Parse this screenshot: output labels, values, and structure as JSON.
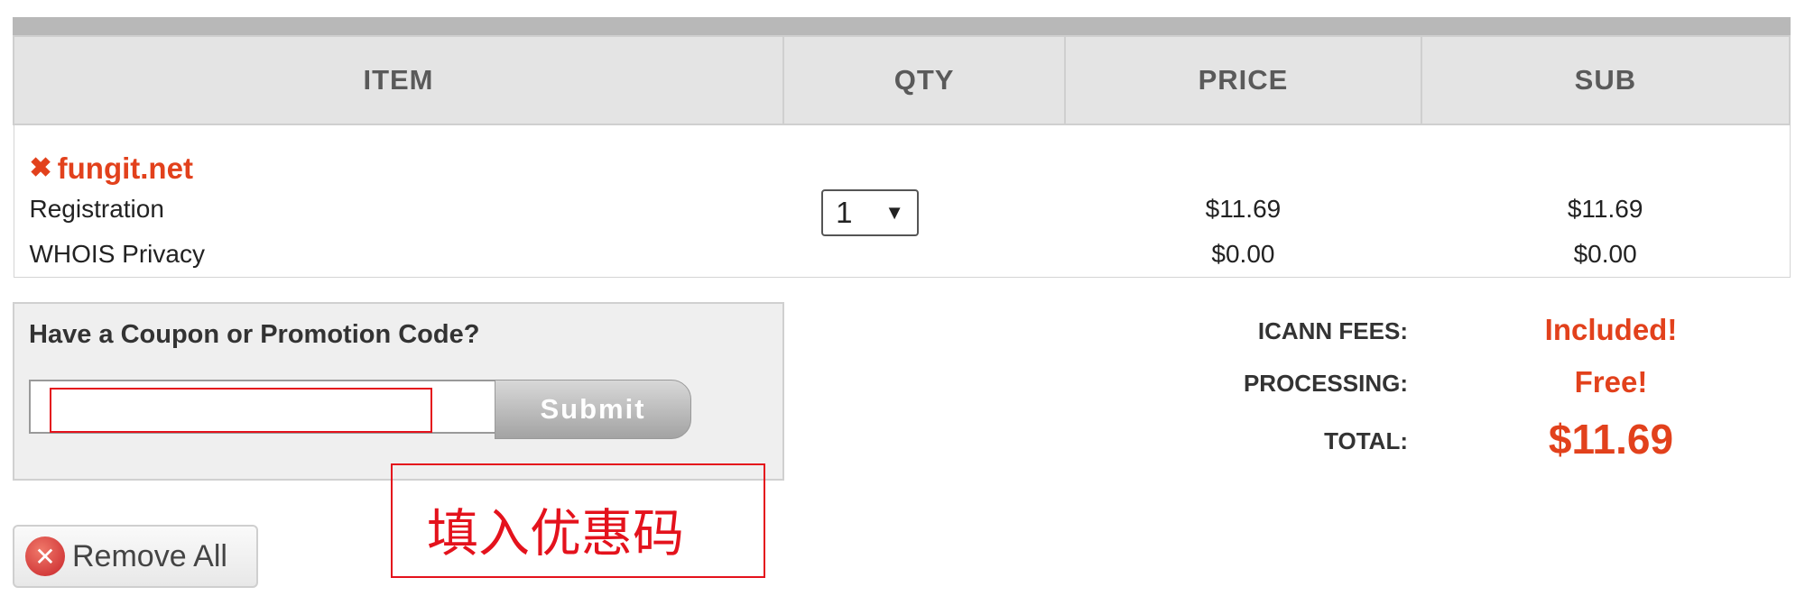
{
  "table": {
    "headers": [
      "ITEM",
      "QTY",
      "PRICE",
      "SUB"
    ],
    "domain": "fungit.net",
    "rows": [
      {
        "label": "Registration",
        "price": "$11.69",
        "sub": "$11.69"
      },
      {
        "label": "WHOIS Privacy",
        "price": "$0.00",
        "sub": "$0.00"
      }
    ],
    "qty": "1",
    "qty_arrow": "▼"
  },
  "coupon": {
    "title": "Have a Coupon or Promotion Code?",
    "input_value": "",
    "submit_label": "Submit"
  },
  "totals": {
    "icann_label": "ICANN FEES:",
    "icann_value": "Included!",
    "processing_label": "PROCESSING:",
    "processing_value": "Free!",
    "total_label": "TOTAL:",
    "total_value": "$11.69"
  },
  "annotation": {
    "text": "填入优惠码"
  },
  "actions": {
    "remove_all_label": "Remove All"
  },
  "icons": {
    "remove_domain": "close-icon",
    "remove_all": "remove-circle-icon",
    "qty_dropdown": "caret-down-icon"
  },
  "colors": {
    "accent": "#e2411c",
    "annotation": "#e4121c",
    "header_bg": "#e4e4e4"
  }
}
